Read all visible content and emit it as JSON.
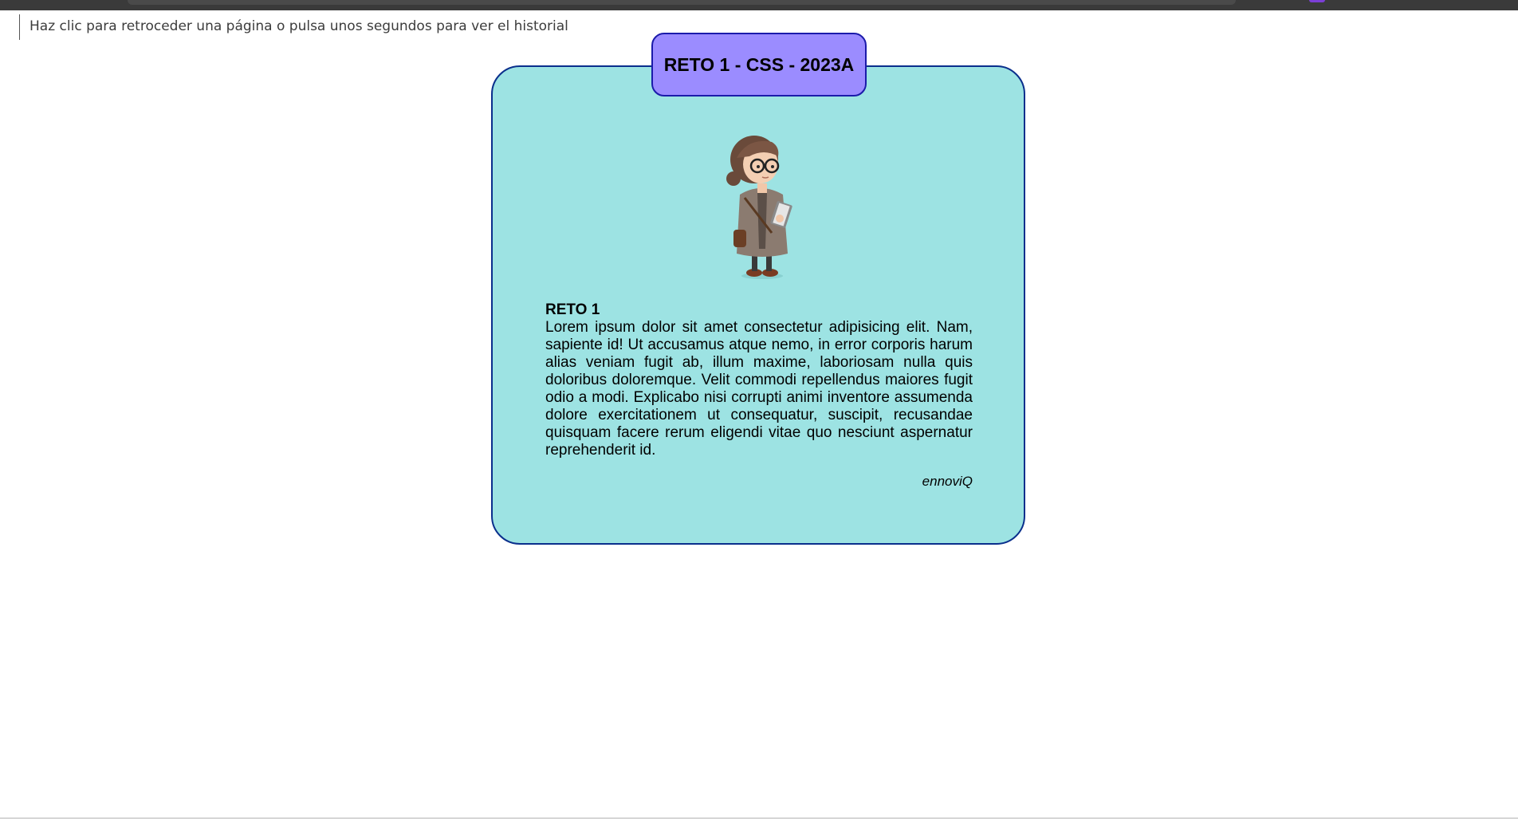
{
  "browser": {
    "back_tooltip": "Haz clic para retroceder una página o pulsa unos segundos para ver el historial"
  },
  "card": {
    "tab_title": "RETO 1 - CSS - 2023A",
    "heading": "RETO 1",
    "body": "Lorem ipsum dolor sit amet consectetur adipisicing elit. Nam, sapiente id! Ut accusamus atque nemo, in error corporis harum alias veniam fugit ab, illum maxime, laboriosam nulla quis doloribus doloremque. Velit commodi repellendus maiores fugit odio a modi. Explicabo nisi corrupti animi inventore assumenda dolore exercitationem ut consequatur, suscipit, recusandae quisquam facere rerum eligendi vitae quo nesciunt aspernatur reprehenderit id.",
    "signature": "ennoviQ",
    "image_subject": "cartoon-girl-with-glasses-holding-book"
  },
  "colors": {
    "card_background": "#9de3e3",
    "card_border": "#0a2f8c",
    "tab_background": "#9b8cff",
    "tab_border": "#1b1baa"
  }
}
